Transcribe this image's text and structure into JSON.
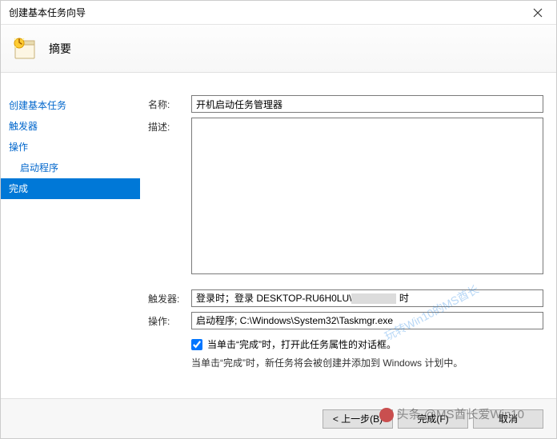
{
  "window": {
    "title": "创建基本任务向导"
  },
  "header": {
    "title": "摘要"
  },
  "sidebar": {
    "items": [
      {
        "label": "创建基本任务",
        "indent": false
      },
      {
        "label": "触发器",
        "indent": false
      },
      {
        "label": "操作",
        "indent": false
      },
      {
        "label": "启动程序",
        "indent": true
      },
      {
        "label": "完成",
        "indent": false,
        "selected": true
      }
    ]
  },
  "form": {
    "name_label": "名称:",
    "name_value": "开机启动任务管理器",
    "desc_label": "描述:",
    "desc_value": "",
    "trigger_label": "触发器:",
    "trigger_value_prefix": "登录时；登录 DESKTOP-RU6H0LU\\",
    "trigger_value_suffix": " 时",
    "action_label": "操作:",
    "action_value": "启动程序; C:\\Windows\\System32\\Taskmgr.exe",
    "checkbox_label": "当单击“完成”时，打开此任务属性的对话框。",
    "note": "当单击“完成”时，新任务将会被创建并添加到 Windows 计划中。"
  },
  "buttons": {
    "back": "< 上一步(B)",
    "finish": "完成(F)",
    "cancel": "取消"
  },
  "watermarks": {
    "diag": "玩转Win10的MS酋长",
    "footer": "头条 @MS酋长爱Win10"
  }
}
